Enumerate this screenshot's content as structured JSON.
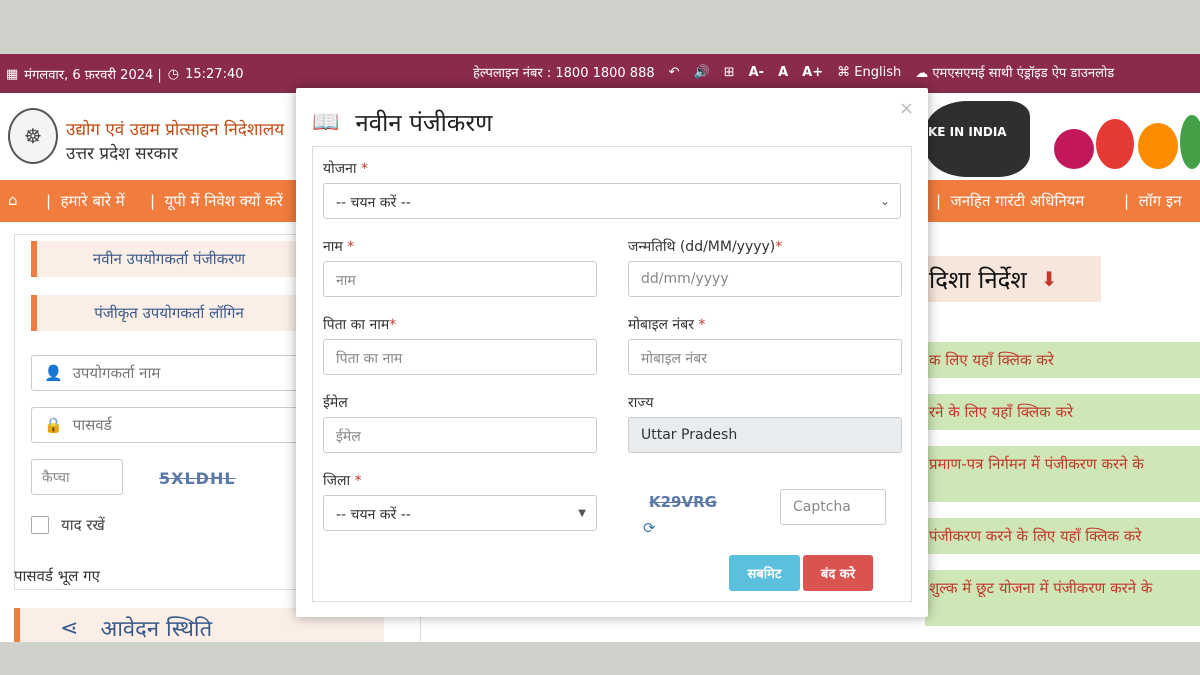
{
  "topbar": {
    "date": "मंगलवार, 6 फ़रवरी 2024 |",
    "time": "15:27:40",
    "helpline": "हेल्पलाइन नंबर : 1800 1800 888",
    "font_minus": "A-",
    "font_normal": "A",
    "font_plus": "A+",
    "language": "English",
    "app_download": "एमएसएमई साथी एंड्रॉइड ऐप डाउनलोड"
  },
  "header": {
    "dept_name": "उद्योग एवं उद्यम प्रोत्साहन निदेशालय",
    "state_name": "उत्तर प्रदेश सरकार",
    "make_in_india": "KE IN INDIA"
  },
  "nav": {
    "items": [
      "हमारे बारे में",
      "यूपी में निवेश क्यों करें",
      "जनहित गारंटी अधिनियम",
      "लॉग इन"
    ]
  },
  "left_panel": {
    "new_user_registration": "नवीन उपयोगकर्ता पंजीकरण",
    "registered_user_login": "पंजीकृत उपयोगकर्ता लॉगिन",
    "username_placeholder": "उपयोगकर्ता नाम",
    "password_placeholder": "पासवर्ड",
    "captcha_placeholder": "कैप्चा",
    "captcha_text": "5XLDHL",
    "remember_me": "याद रखें",
    "forgot_password": "पासवर्ड भूल गए",
    "application_status": "आवेदन स्थिति"
  },
  "right_content": {
    "guidelines": "दिशा निर्देश",
    "links": [
      "क लिए यहाँ क्लिक करे",
      "रने के लिए यहाँ क्लिक करे",
      "प्रमाण-पत्र निर्गमन में पंजीकरण करने के",
      "पंजीकरण करने के लिए यहाँ क्लिक करे",
      "शुल्क में छूट योजना में पंजीकरण करने के"
    ]
  },
  "modal": {
    "title": "नवीन पंजीकरण",
    "scheme_label": "योजना",
    "scheme_value": "-- चयन करें --",
    "name_label": "नाम",
    "name_placeholder": "नाम",
    "dob_label": "जन्मतिथि (dd/MM/yyyy)",
    "dob_placeholder": "dd/mm/yyyy",
    "father_label": "पिता का नाम",
    "father_placeholder": "पिता का नाम",
    "mobile_label": "मोबाइल नंबर",
    "mobile_placeholder": "मोबाइल नंबर",
    "email_label": "ईमेल",
    "email_placeholder": "ईमेल",
    "state_label": "राज्य",
    "state_value": "Uttar Pradesh",
    "district_label": "जिला",
    "district_value": "-- चयन करें --",
    "captcha_text": "K29VRG",
    "captcha_placeholder": "Captcha",
    "submit_label": "सबमिट",
    "close_label": "बंद करे",
    "required_mark": "*"
  },
  "colors": {
    "topbar": "#8a2a4c",
    "nav": "#f07c3d",
    "submit": "#5bc0de",
    "close": "#d9534f",
    "link_bg": "#cfe7b7"
  }
}
